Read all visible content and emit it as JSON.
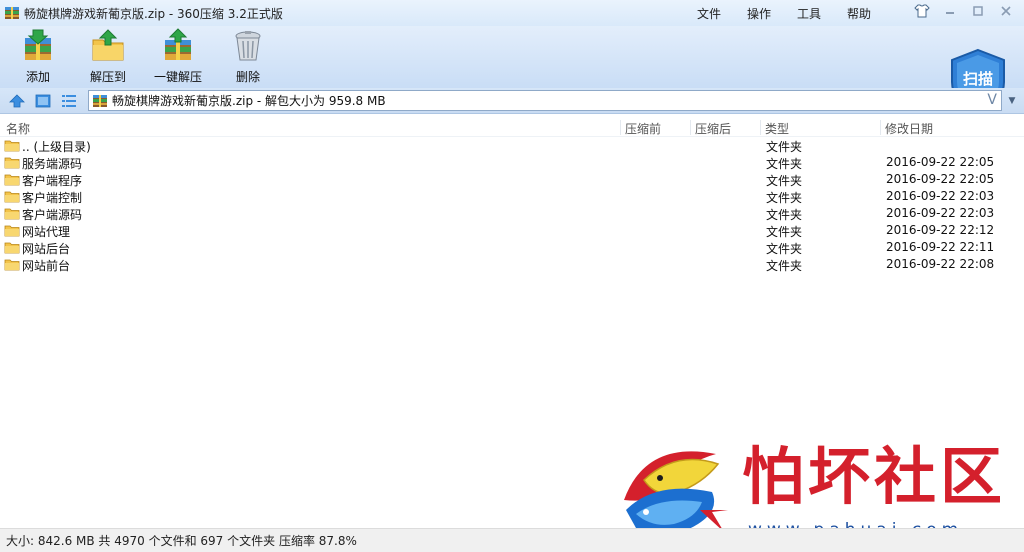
{
  "window": {
    "title": "畅旋棋牌游戏新葡京版.zip - 360压缩 3.2正式版"
  },
  "menu": [
    "文件",
    "操作",
    "工具",
    "帮助"
  ],
  "toolbar": {
    "add_label": "添加",
    "extract_to_label": "解压到",
    "one_click_extract_label": "一键解压",
    "delete_label": "删除",
    "scan_label": "扫描"
  },
  "address": {
    "path": "畅旋棋牌游戏新葡京版.zip - 解包大小为 959.8 MB",
    "v_glyph": "V"
  },
  "columns": {
    "name": "名称",
    "compressed": "压缩前",
    "after": "压缩后",
    "type": "类型",
    "modified": "修改日期"
  },
  "rows": [
    {
      "name": ".. (上级目录)",
      "type": "文件夹",
      "modified": ""
    },
    {
      "name": "服务端源码",
      "type": "文件夹",
      "modified": "2016-09-22 22:05"
    },
    {
      "name": "客户端程序",
      "type": "文件夹",
      "modified": "2016-09-22 22:05"
    },
    {
      "name": "客户端控制",
      "type": "文件夹",
      "modified": "2016-09-22 22:03"
    },
    {
      "name": "客户端源码",
      "type": "文件夹",
      "modified": "2016-09-22 22:03"
    },
    {
      "name": "网站代理",
      "type": "文件夹",
      "modified": "2016-09-22 22:12"
    },
    {
      "name": "网站后台",
      "type": "文件夹",
      "modified": "2016-09-22 22:11"
    },
    {
      "name": "网站前台",
      "type": "文件夹",
      "modified": "2016-09-22 22:08"
    }
  ],
  "status": {
    "text": "大小: 842.6 MB 共 4970 个文件和 697 个文件夹 压缩率 87.8%"
  },
  "watermark": {
    "text": "怕坏社区",
    "url": "www.pahuai.com"
  },
  "colors": {
    "accent": "#2f7fd6",
    "watermark_red": "#d4202c",
    "watermark_blue": "#1c4fa0"
  }
}
